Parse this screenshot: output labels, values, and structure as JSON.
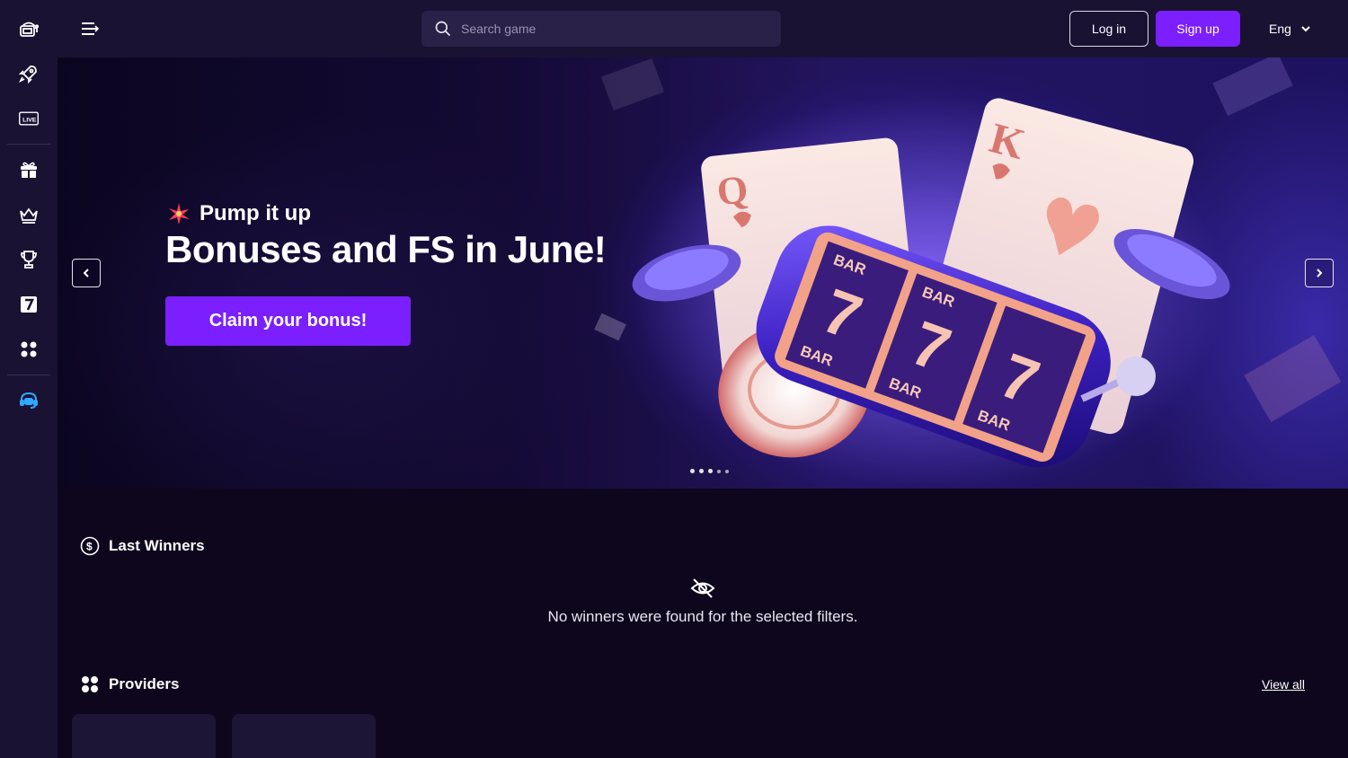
{
  "header": {
    "search_placeholder": "Search game",
    "login_label": "Log in",
    "signup_label": "Sign up",
    "language": "Eng"
  },
  "sidebar": {
    "items": [
      {
        "name": "slots",
        "icon": "slot-machine-icon"
      },
      {
        "name": "crash",
        "icon": "rocket-icon"
      },
      {
        "name": "live",
        "icon": "live-icon"
      },
      {
        "name": "promotions",
        "icon": "gift-icon"
      },
      {
        "name": "vip",
        "icon": "crown-icon"
      },
      {
        "name": "tournaments",
        "icon": "trophy-icon"
      },
      {
        "name": "lucky-seven",
        "icon": "seven-icon"
      },
      {
        "name": "providers",
        "icon": "grid-icon"
      },
      {
        "name": "support",
        "icon": "support-icon"
      }
    ]
  },
  "hero": {
    "subtitle": "Pump it up",
    "title": "Bonuses and FS in June!",
    "cta": "Claim your bonus!",
    "slides_count": 5,
    "active_slide": 2,
    "reel_labels": [
      "BAR",
      "7",
      "BAR"
    ],
    "cards": [
      "Q",
      "K"
    ]
  },
  "last_winners": {
    "title": "Last Winners",
    "empty_message": "No winners were found for the selected filters."
  },
  "providers": {
    "title": "Providers",
    "view_all": "View all"
  },
  "colors": {
    "accent": "#7b1fff",
    "sidebar_bg": "#1a1233",
    "page_bg": "#0d061d"
  }
}
